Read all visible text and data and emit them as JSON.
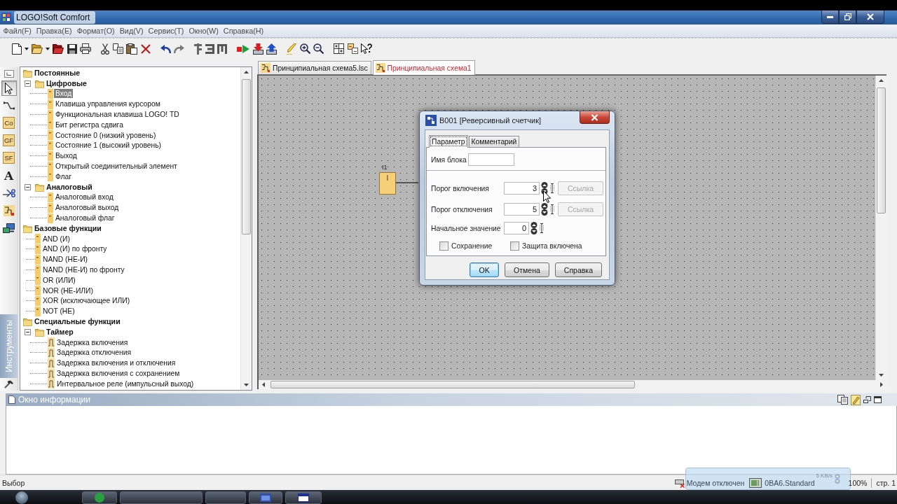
{
  "window": {
    "title": "LOGO!Soft Comfort"
  },
  "menu": [
    "Файл(F)",
    "Правка(E)",
    "Формат(O)",
    "Вид(V)",
    "Сервис(T)",
    "Окно(W)",
    "Справка(H)"
  ],
  "toolbar": [
    {
      "kind": "new"
    },
    {
      "kind": "dropdown"
    },
    {
      "kind": "open"
    },
    {
      "kind": "dropdown"
    },
    {
      "kind": "open-red"
    },
    {
      "kind": "save"
    },
    {
      "kind": "print"
    },
    {
      "kind": "separator"
    },
    {
      "kind": "cut"
    },
    {
      "kind": "copy"
    },
    {
      "kind": "paste"
    },
    {
      "kind": "delete"
    },
    {
      "kind": "separator"
    },
    {
      "kind": "undo"
    },
    {
      "kind": "redo"
    },
    {
      "kind": "separator"
    },
    {
      "kind": "align-vertical"
    },
    {
      "kind": "align-right"
    },
    {
      "kind": "align-top"
    },
    {
      "kind": "separator"
    },
    {
      "kind": "simulate"
    },
    {
      "kind": "download"
    },
    {
      "kind": "upload"
    },
    {
      "kind": "separator"
    },
    {
      "kind": "pen"
    },
    {
      "kind": "zoom-in"
    },
    {
      "kind": "zoom-out"
    },
    {
      "kind": "separator"
    },
    {
      "kind": "grid"
    },
    {
      "kind": "blocks"
    },
    {
      "kind": "help"
    }
  ],
  "tools": {
    "title": "Инструменты",
    "items": [
      {
        "kind": "collapse",
        "selected": false
      },
      {
        "kind": "pointer",
        "selected": true
      },
      {
        "kind": "connector",
        "selected": false
      },
      {
        "kind": "tile",
        "label": "Co",
        "selected": false
      },
      {
        "kind": "tile",
        "label": "GF",
        "selected": false
      },
      {
        "kind": "tile",
        "label": "SF",
        "selected": false
      },
      {
        "kind": "text",
        "label": "A",
        "selected": false
      },
      {
        "kind": "cut",
        "selected": false
      },
      {
        "kind": "block",
        "selected": false
      },
      {
        "kind": "simulation",
        "selected": false
      }
    ]
  },
  "tree": [
    {
      "label": "Постоянные",
      "kind": "folder",
      "selected": false,
      "children": [
        {
          "label": "Цифровые",
          "kind": "folder",
          "expanded": true,
          "selected": false,
          "children": [
            {
              "label": "Вход",
              "kind": "block",
              "selected": true
            },
            {
              "label": "Клавиша управления курсором",
              "kind": "block",
              "selected": false
            },
            {
              "label": "Функциональная клавиша LOGO! TD",
              "kind": "block",
              "selected": false
            },
            {
              "label": "Бит регистра сдвига",
              "kind": "block",
              "selected": false
            },
            {
              "label": "Состояние 0 (низкий уровень)",
              "kind": "block",
              "selected": false
            },
            {
              "label": "Состояние 1 (высокий уровень)",
              "kind": "block",
              "selected": false
            },
            {
              "label": "Выход",
              "kind": "block",
              "selected": false
            },
            {
              "label": "Открытый соединительный элемент",
              "kind": "block",
              "selected": false
            },
            {
              "label": "Флаг",
              "kind": "block",
              "selected": false
            }
          ]
        },
        {
          "label": "Аналоговый",
          "kind": "folder",
          "expanded": true,
          "selected": false,
          "children": [
            {
              "label": "Аналоговый вход",
              "kind": "block",
              "selected": false
            },
            {
              "label": "Аналоговый выход",
              "kind": "block",
              "selected": false
            },
            {
              "label": "Аналоговый флаг",
              "kind": "block",
              "selected": false
            }
          ]
        }
      ]
    },
    {
      "label": "Базовые функции",
      "kind": "folder",
      "selected": false,
      "children": [
        {
          "label": "AND (И)",
          "kind": "block",
          "selected": false
        },
        {
          "label": "AND (И) по фронту",
          "kind": "block",
          "selected": false
        },
        {
          "label": "NAND (НЕ-И)",
          "kind": "block",
          "selected": false
        },
        {
          "label": "NAND (НЕ-И) по фронту",
          "kind": "block",
          "selected": false
        },
        {
          "label": "OR (ИЛИ)",
          "kind": "block",
          "selected": false
        },
        {
          "label": "NOR (НЕ-ИЛИ)",
          "kind": "block",
          "selected": false
        },
        {
          "label": "XOR (исключающее ИЛИ)",
          "kind": "block",
          "selected": false
        },
        {
          "label": "NOT (НЕ)",
          "kind": "block",
          "selected": false
        }
      ]
    },
    {
      "label": "Специальные функции",
      "kind": "folder",
      "selected": false,
      "children": [
        {
          "label": "Таймер",
          "kind": "folder",
          "expanded": true,
          "selected": false,
          "children": [
            {
              "label": "Задержка включения",
              "kind": "timer",
              "selected": false
            },
            {
              "label": "Задержка отключения",
              "kind": "timer",
              "selected": false
            },
            {
              "label": "Задержка включения и отключения",
              "kind": "timer",
              "selected": false
            },
            {
              "label": "Задержка включения с сохранением",
              "kind": "timer",
              "selected": false
            },
            {
              "label": "Интервальное реле (импульсный выход)",
              "kind": "timer",
              "selected": false
            }
          ]
        }
      ]
    }
  ],
  "documents": {
    "tabs": [
      {
        "label": "Принципиальная схема5.lsc",
        "selected": false
      },
      {
        "label": "Принципиальная схема1",
        "selected": true
      }
    ],
    "blocks": [
      {
        "label": "I1",
        "symbol": "I"
      }
    ]
  },
  "dialog": {
    "title": "B001 [Реверсивный счетчик]",
    "tabs": [
      {
        "label": "Параметр",
        "selected": true
      },
      {
        "label": "Комментарий",
        "selected": false
      }
    ],
    "name_field": {
      "label": "Имя блока"
    },
    "fields": [
      {
        "label": "Порог включения",
        "value": "3",
        "link": {
          "label": "Ссылка",
          "disabled": true
        }
      },
      {
        "label": "Порог отключения",
        "value": "5",
        "link": {
          "label": "Ссылка",
          "disabled": true
        }
      },
      {
        "label": "Начальное значение",
        "value": "0"
      }
    ],
    "checkboxes": [
      {
        "label": "Сохранение",
        "checked": false
      },
      {
        "label": "Защита включена",
        "checked": false
      }
    ],
    "buttons": [
      {
        "label": "OK",
        "default": true
      },
      {
        "label": "Отмена",
        "default": false
      },
      {
        "label": "Справка",
        "default": false
      }
    ]
  },
  "info_window": {
    "title": "Окно информации"
  },
  "status_bar": {
    "mode": "Выбор",
    "connection": "Модем отключен",
    "device": "0BA6.Standard",
    "zoom": "100%",
    "page": "стр. 1"
  },
  "network_meter": {
    "speed": "5 KB/s"
  }
}
